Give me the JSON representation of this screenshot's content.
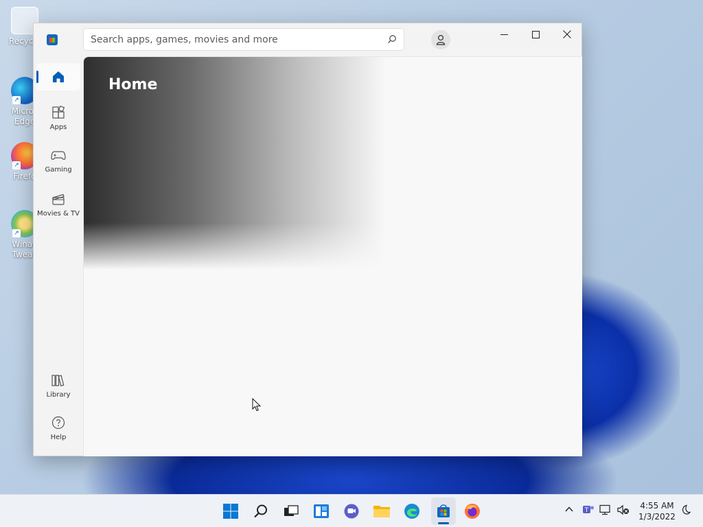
{
  "desktop": {
    "icons": [
      {
        "label": "Recycle"
      },
      {
        "label": "Micros Edge"
      },
      {
        "label": "Firefo"
      },
      {
        "label": "Winae Tweak"
      }
    ]
  },
  "window": {
    "search_placeholder": "Search apps, games, movies and more",
    "nav": {
      "home": "Home",
      "apps": "Apps",
      "gaming": "Gaming",
      "movies": "Movies & TV",
      "library": "Library",
      "help": "Help"
    },
    "page_title": "Home"
  },
  "taskbar": {
    "time": "4:55 AM",
    "date": "1/3/2022"
  },
  "colors": {
    "accent": "#005fb8"
  }
}
